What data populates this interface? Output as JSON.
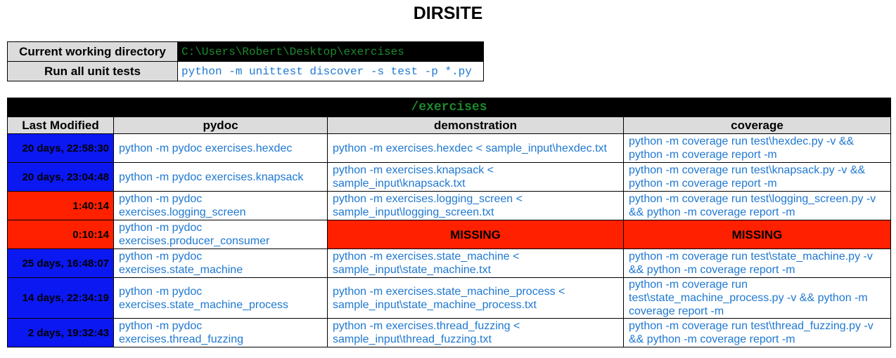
{
  "title": "DIRSITE",
  "info": {
    "cwd_label": "Current working directory",
    "cwd_value": "C:\\Users\\Robert\\Desktop\\exercises",
    "tests_label": "Run all unit tests",
    "tests_value": "python -m unittest discover -s test -p *.py"
  },
  "table": {
    "dir_title": "/exercises",
    "headers": [
      "Last Modified",
      "pydoc",
      "demonstration",
      "coverage"
    ],
    "rows": [
      {
        "modified": "20 days, 22:58:30",
        "pydoc": "python -m pydoc exercises.hexdec",
        "demo": "python -m exercises.hexdec < sample_input\\hexdec.txt",
        "coverage": "python -m coverage run test\\hexdec.py -v && python -m coverage report -m"
      },
      {
        "modified": "20 days, 23:04:48",
        "pydoc": "python -m pydoc exercises.knapsack",
        "demo": "python -m exercises.knapsack < sample_input\\knapsack.txt",
        "coverage": "python -m coverage run test\\knapsack.py -v && python -m coverage report -m"
      },
      {
        "modified": "1:40:14",
        "pydoc": "python -m pydoc exercises.logging_screen",
        "demo": "python -m exercises.logging_screen < sample_input\\logging_screen.txt",
        "coverage": "python -m coverage run test\\logging_screen.py -v && python -m coverage report -m"
      },
      {
        "modified": "0:10:14",
        "pydoc": "python -m pydoc exercises.producer_consumer",
        "demo": "MISSING",
        "coverage": "MISSING"
      },
      {
        "modified": "25 days, 16:48:07",
        "pydoc": "python -m pydoc exercises.state_machine",
        "demo": "python -m exercises.state_machine < sample_input\\state_machine.txt",
        "coverage": "python -m coverage run test\\state_machine.py -v && python -m coverage report -m"
      },
      {
        "modified": "14 days, 22:34:19",
        "pydoc": "python -m pydoc exercises.state_machine_process",
        "demo": "python -m exercises.state_machine_process < sample_input\\state_machine_process.txt",
        "coverage": "python -m coverage run test\\state_machine_process.py -v && python -m coverage report -m"
      },
      {
        "modified": "2 days, 19:32:43",
        "pydoc": "python -m pydoc exercises.thread_fuzzing",
        "demo": "python -m exercises.thread_fuzzing < sample_input\\thread_fuzzing.txt",
        "coverage": "python -m coverage run test\\thread_fuzzing.py -v && python -m coverage report -m"
      }
    ]
  },
  "colors": {
    "old": "#0b18f2",
    "recent": "#ff2000",
    "missing": "#ff2000",
    "link": "#1f78d1",
    "cwd_text": "#1c8a2c"
  }
}
